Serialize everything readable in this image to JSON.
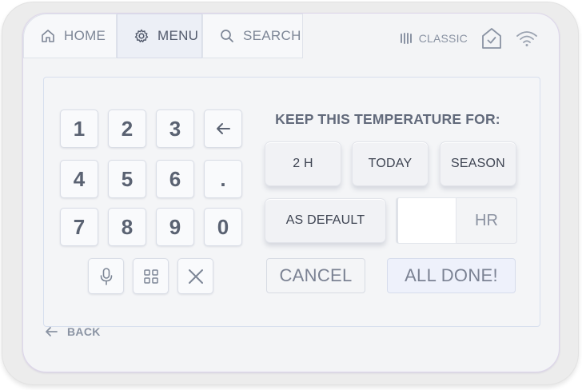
{
  "nav": {
    "home_label": "HOME",
    "menu_label": "MENU",
    "search_label": "SEARCH",
    "home_icon": "home-icon",
    "menu_icon": "gear-icon",
    "search_icon": "search-icon"
  },
  "status": {
    "mode_label": "CLASSIC",
    "mode_icon": "classic-bars-icon",
    "home_status_icon": "house-check-icon",
    "wifi_icon": "wifi-icon"
  },
  "keypad": {
    "keys": [
      "1",
      "2",
      "3",
      "4",
      "5",
      "6",
      "7",
      "8",
      "9",
      ".",
      "0"
    ],
    "backspace_icon": "backspace-arrow-icon",
    "mic_icon": "microphone-icon",
    "grid_icon": "grid-icon",
    "clear_icon": "close-icon"
  },
  "hold": {
    "heading": "KEEP THIS TEMPERATURE FOR:",
    "options": [
      "2 H",
      "TODAY",
      "SEASON",
      "AS DEFAULT"
    ],
    "hours_value": "",
    "hours_unit": "HR"
  },
  "actions": {
    "cancel_label": "CANCEL",
    "done_label": "ALL DONE!"
  },
  "footer": {
    "back_label": "BACK"
  },
  "colors": {
    "device": "#ececec",
    "screen": "#f3f4f6",
    "text": "#5c6373",
    "accent_panel_border": "#d7dfee",
    "done_bg": "#eef1fb"
  }
}
